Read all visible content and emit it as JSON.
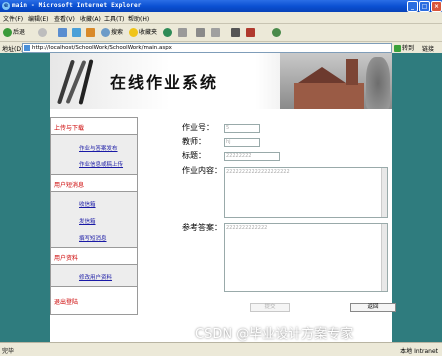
{
  "window": {
    "title": "main - Microsoft Internet Explorer"
  },
  "menu": [
    "文件(F)",
    "编辑(E)",
    "查看(V)",
    "收藏(A)",
    "工具(T)",
    "帮助(H)"
  ],
  "toolbar": {
    "back": "后退",
    "search": "搜索",
    "favorites": "收藏夹"
  },
  "address": {
    "label": "地址(D)",
    "url": "http://localhost/SchoolWork/SchoolWork/main.aspx",
    "go": "转到",
    "links": "链接"
  },
  "banner": {
    "title": "在线作业系统"
  },
  "sidebar": {
    "sections": [
      {
        "label": "上传与下载",
        "items": [
          "作业与答案发布",
          "作业信息或稿上传"
        ]
      },
      {
        "label": "用户短消息",
        "items": [
          "收信箱",
          "发信箱",
          "撰写短消息"
        ]
      },
      {
        "label": "用户资料",
        "items": [
          "修改用户资料"
        ]
      },
      {
        "label": "退出登陆",
        "items": []
      }
    ]
  },
  "form": {
    "number_label": "作业号：",
    "number_value": "5",
    "teacher_label": "教师：",
    "teacher_value": "hj",
    "title_label": "标题：",
    "title_value": "22222222",
    "content_label": "作业内容：",
    "content_value": "22222222222222222222",
    "answer_label": "参考答案：",
    "answer_value": "2222222222222",
    "submit_label": "提交",
    "back_label": "返回"
  },
  "status": {
    "left": "完毕",
    "right": "本地 Intranet"
  },
  "watermark": "CSDN @毕业设计方案专家"
}
